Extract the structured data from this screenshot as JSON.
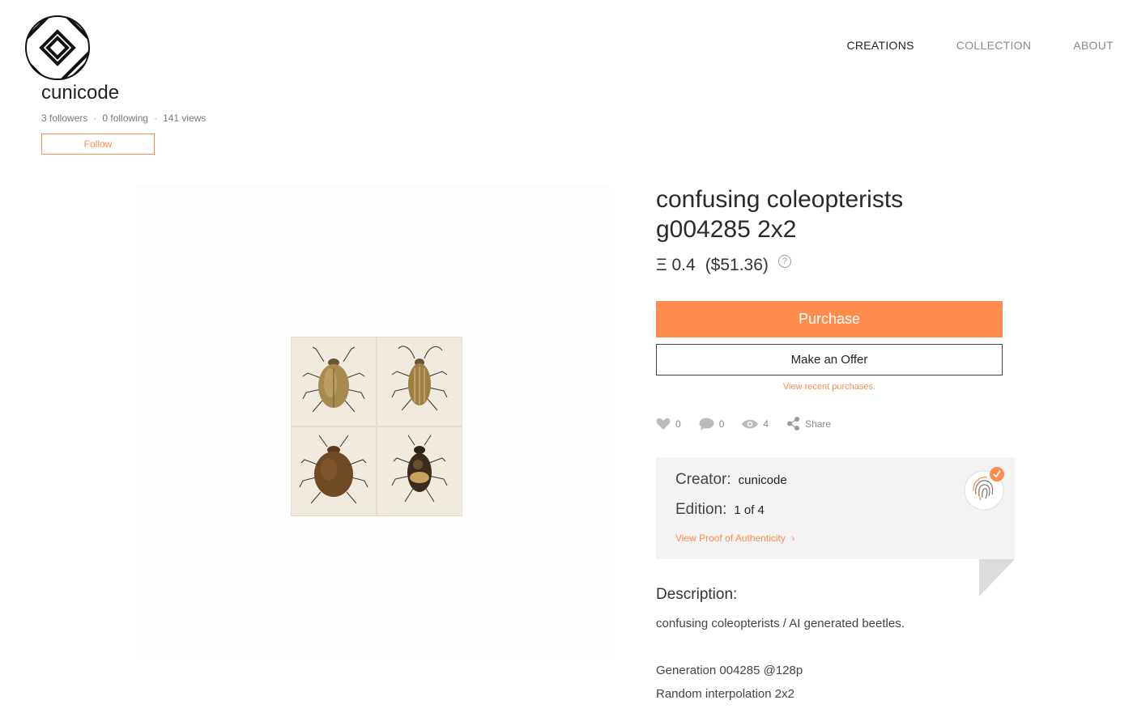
{
  "brand": {
    "logo_icon": "striped-circle-logo-icon"
  },
  "nav": {
    "items": [
      {
        "label": "CREATIONS",
        "active": true
      },
      {
        "label": "COLLECTION",
        "active": false
      },
      {
        "label": "ABOUT",
        "active": false
      }
    ]
  },
  "profile": {
    "username": "cunicode",
    "followers": "3 followers",
    "following": "0 following",
    "views": "141 views",
    "separator": "·",
    "follow_label": "Follow"
  },
  "artwork": {
    "title": "confusing coleopterists g004285 2x2",
    "price_eth": "Ξ 0.4",
    "price_usd": "($51.36)",
    "help_glyph": "?",
    "purchase_label": "Purchase",
    "offer_label": "Make an Offer",
    "recent_label": "View recent purchases."
  },
  "social": {
    "likes": "0",
    "comments": "0",
    "views": "4",
    "share_label": "Share"
  },
  "certificate": {
    "creator_label": "Creator:",
    "creator_value": "cunicode",
    "edition_label": "Edition:",
    "edition_value": "1 of 4",
    "proof_label": "View Proof of Authenticity",
    "proof_chevron": "›",
    "badge_icon": "fingerprint-verified-icon"
  },
  "description": {
    "heading": "Description:",
    "lines": [
      "confusing coleopterists / AI generated beetles.",
      "Generation 004285 @128p",
      "Random interpolation 2x2"
    ]
  },
  "colors": {
    "accent": "#ff8c4f",
    "text": "#333333",
    "muted": "#888888",
    "panel": "#f3f3f3"
  }
}
